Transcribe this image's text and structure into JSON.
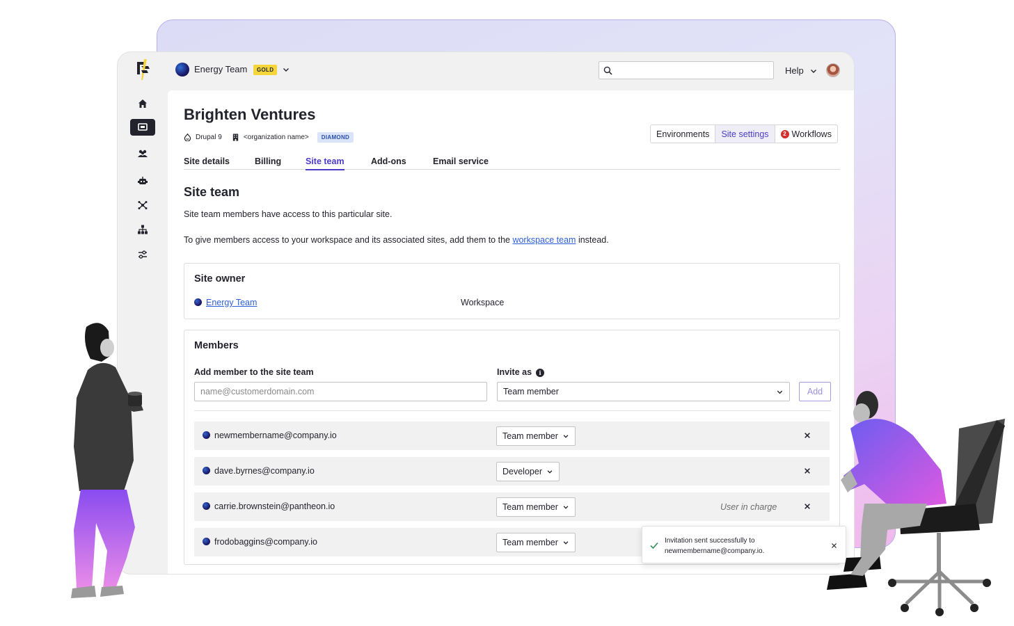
{
  "org": {
    "name": "Energy Team",
    "tier_badge": "GOLD"
  },
  "search": {
    "placeholder": "",
    "value": ""
  },
  "header": {
    "help_label": "Help"
  },
  "site": {
    "title": "Brighten Ventures",
    "platform": "Drupal 9",
    "organization": "<organization name>",
    "plan_badge": "DIAMOND"
  },
  "segments": {
    "environments": "Environments",
    "site_settings": "Site settings",
    "workflows": "Workflows",
    "workflows_count": "2"
  },
  "tabs": [
    "Site details",
    "Billing",
    "Site team",
    "Add-ons",
    "Email service"
  ],
  "site_team": {
    "heading": "Site team",
    "intro": "Site team members have access to this particular site.",
    "para_prefix": "To give members access to your workspace and its associated sites, add them to the ",
    "para_link": "workspace team",
    "para_suffix": " instead."
  },
  "owner": {
    "heading": "Site owner",
    "name": "Energy Team",
    "type": "Workspace"
  },
  "members": {
    "heading": "Members",
    "add_label": "Add member to the site team",
    "email_placeholder": "name@customerdomain.com",
    "invite_label": "Invite as",
    "invite_value": "Team member",
    "add_button": "Add",
    "rows": [
      {
        "email": "newmembername@company.io",
        "role": "Team member",
        "note": ""
      },
      {
        "email": "dave.byrnes@company.io",
        "role": "Developer",
        "note": ""
      },
      {
        "email": "carrie.brownstein@pantheon.io",
        "role": "Team member",
        "note": "User in charge"
      },
      {
        "email": "frodobaggins@company.io",
        "role": "Team member",
        "note": ""
      }
    ]
  },
  "toast": {
    "line1": "Invitation sent successfully to",
    "line2": "newmembername@company.io."
  },
  "colors": {
    "accent": "#4b3bc6",
    "gold": "#f4d63b",
    "link": "#2e5fd8",
    "error_badge": "#d22f2f"
  },
  "icons": [
    "pantheon-logo-icon",
    "home-icon",
    "sites-icon",
    "team-icon",
    "robot-icon",
    "integrations-icon",
    "hierarchy-icon",
    "settings-sliders-icon",
    "search-icon",
    "chevron-down-icon",
    "drupal-icon",
    "building-icon",
    "info-icon",
    "close-icon",
    "check-icon"
  ]
}
